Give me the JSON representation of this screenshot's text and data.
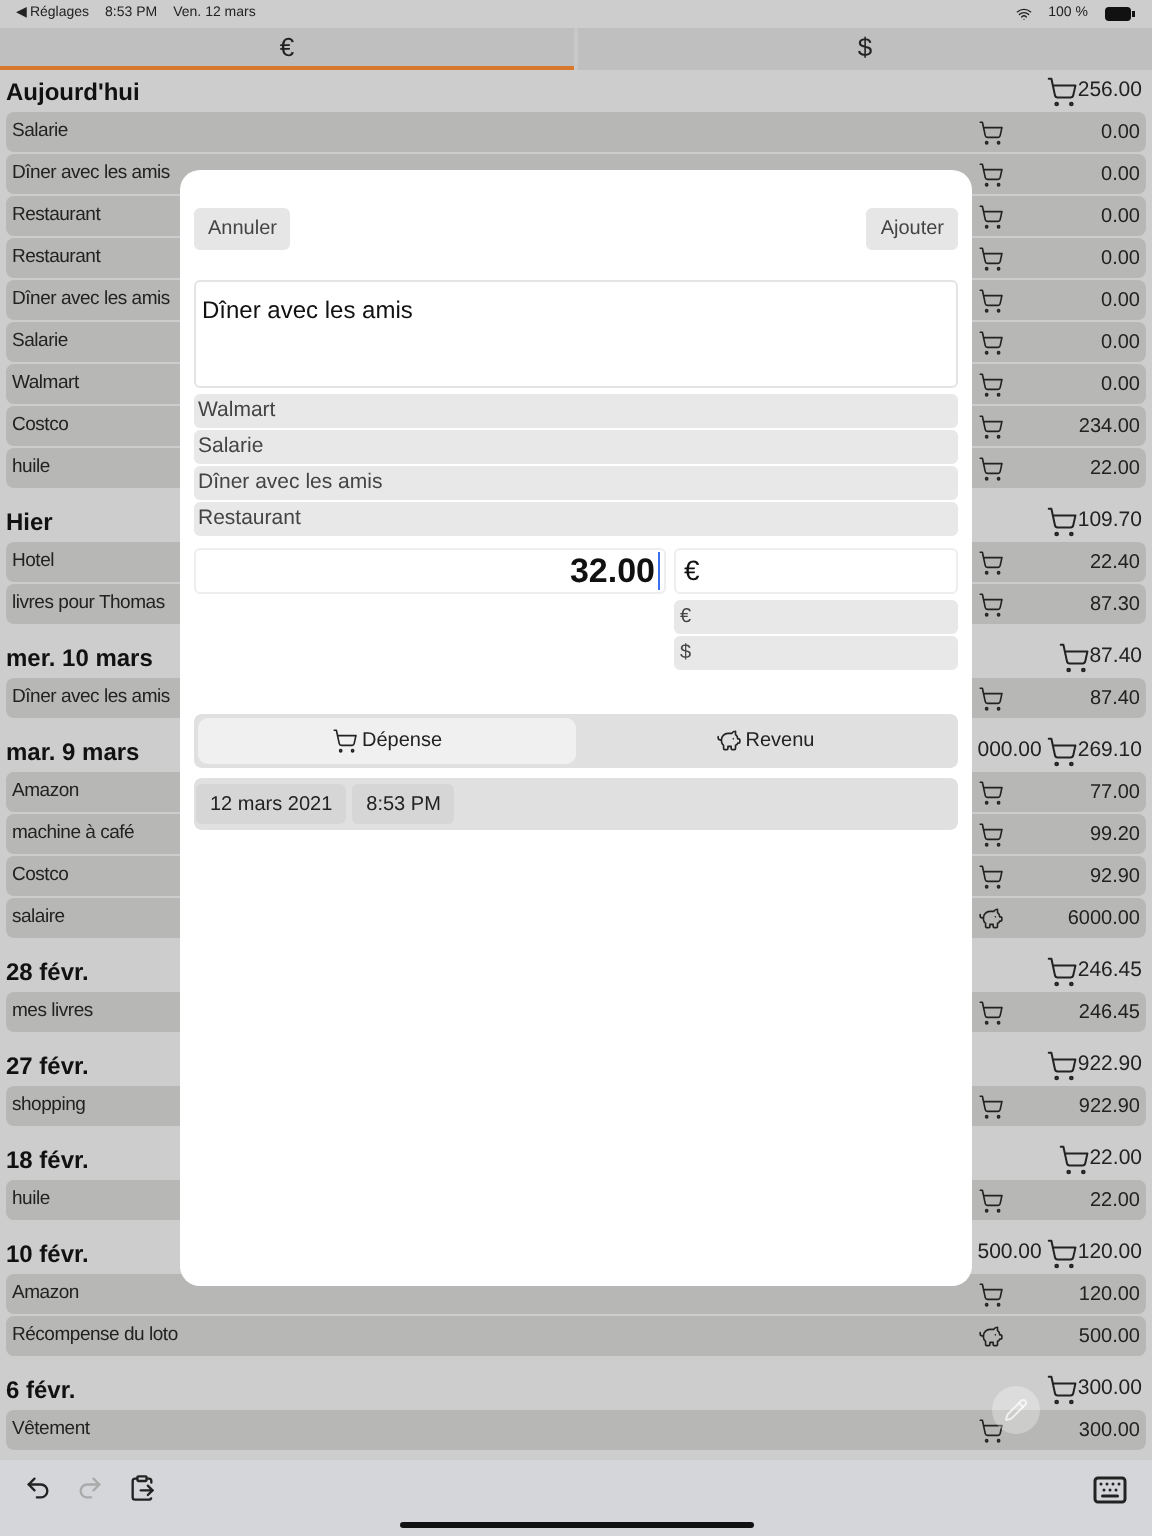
{
  "status_bar": {
    "back": "◀ Réglages",
    "time": "8:53 PM",
    "date": "Ven. 12 mars",
    "battery": "100 %"
  },
  "tabs": [
    {
      "label": "€",
      "selected": true
    },
    {
      "label": "$",
      "selected": false
    }
  ],
  "sections": [
    {
      "title": "Aujourd'hui",
      "total": "256.00",
      "rows": [
        {
          "name": "Salarie",
          "kind": "expense",
          "amount": "0.00"
        },
        {
          "name": "Dîner avec les amis",
          "kind": "expense",
          "amount": "0.00"
        },
        {
          "name": "Restaurant",
          "kind": "expense",
          "amount": "0.00"
        },
        {
          "name": "Restaurant",
          "kind": "expense",
          "amount": "0.00"
        },
        {
          "name": "Dîner avec les amis",
          "kind": "expense",
          "amount": "0.00"
        },
        {
          "name": "Salarie",
          "kind": "expense",
          "amount": "0.00"
        },
        {
          "name": "Walmart",
          "kind": "expense",
          "amount": "0.00"
        },
        {
          "name": "Costco",
          "kind": "expense",
          "amount": "234.00"
        },
        {
          "name": "huile",
          "kind": "expense",
          "amount": "22.00"
        }
      ]
    },
    {
      "title": "Hier",
      "total": "109.70",
      "rows": [
        {
          "name": "Hotel",
          "kind": "expense",
          "amount": "22.40"
        },
        {
          "name": "livres pour Thomas",
          "kind": "expense",
          "amount": "87.30"
        }
      ]
    },
    {
      "title": "mer. 10 mars",
      "total": "87.40",
      "rows": [
        {
          "name": "Dîner avec les amis",
          "kind": "expense",
          "amount": "87.40"
        }
      ]
    },
    {
      "title": "mar. 9 mars",
      "income_total": "000.00",
      "total": "269.10",
      "rows": [
        {
          "name": "Amazon",
          "kind": "expense",
          "amount": "77.00"
        },
        {
          "name": "machine à café",
          "kind": "expense",
          "amount": "99.20"
        },
        {
          "name": "Costco",
          "kind": "expense",
          "amount": "92.90"
        },
        {
          "name": "salaire",
          "kind": "income",
          "amount": "6000.00"
        }
      ]
    },
    {
      "title": "28 févr.",
      "total": "246.45",
      "rows": [
        {
          "name": "mes livres",
          "kind": "expense",
          "amount": "246.45"
        }
      ]
    },
    {
      "title": "27 févr.",
      "total": "922.90",
      "rows": [
        {
          "name": "shopping",
          "kind": "expense",
          "amount": "922.90"
        }
      ]
    },
    {
      "title": "18 févr.",
      "total": "22.00",
      "rows": [
        {
          "name": "huile",
          "kind": "expense",
          "amount": "22.00"
        }
      ]
    },
    {
      "title": "10 févr.",
      "income_total": "500.00",
      "total": "120.00",
      "rows": [
        {
          "name": "Amazon",
          "kind": "expense",
          "amount": "120.00"
        },
        {
          "name": "Récompense du loto",
          "kind": "income",
          "amount": "500.00"
        }
      ]
    },
    {
      "title": "6 févr.",
      "total": "300.00",
      "rows": [
        {
          "name": "Vêtement",
          "kind": "expense",
          "amount": "300.00"
        }
      ]
    }
  ],
  "modal": {
    "cancel": "Annuler",
    "add": "Ajouter",
    "description": "Dîner avec les amis",
    "suggestions": [
      "Walmart",
      "Salarie",
      "Dîner avec les amis",
      "Restaurant"
    ],
    "amount": "32.00",
    "currency": "€",
    "currency_options": [
      "€",
      "$"
    ],
    "type_tabs": [
      {
        "label": "Dépense",
        "kind": "expense",
        "selected": true
      },
      {
        "label": "Revenu",
        "kind": "income",
        "selected": false
      }
    ],
    "date": "12 mars 2021",
    "time": "8:53 PM"
  },
  "toolbar": [
    {
      "kind": "undo",
      "disabled": false
    },
    {
      "kind": "redo",
      "disabled": true
    },
    {
      "kind": "paste",
      "disabled": false
    }
  ]
}
